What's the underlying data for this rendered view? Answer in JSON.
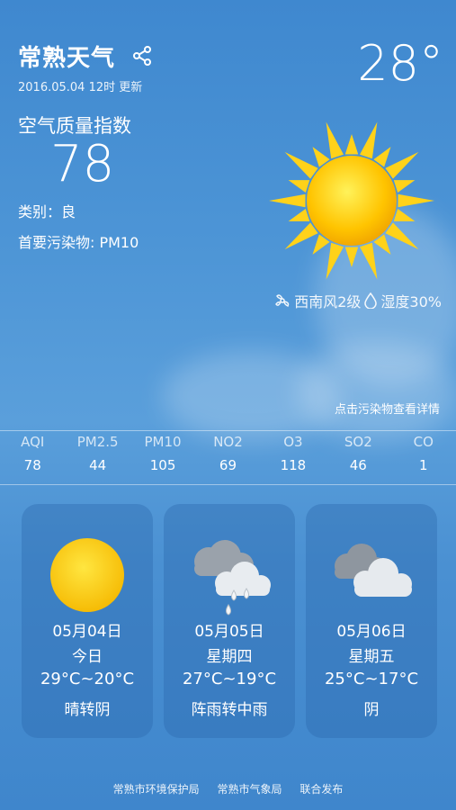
{
  "header": {
    "city": "常熟天气",
    "update_time": "2016.05.04 12时 更新",
    "temperature": "28°"
  },
  "air_quality": {
    "title": "空气质量指数",
    "value": "78",
    "category": "类别：良",
    "primary_pollutant": "首要污染物: PM10"
  },
  "conditions": {
    "wind": "西南风2级",
    "humidity": "湿度30%",
    "detail_link": "点击污染物查看详情"
  },
  "pollutants": [
    {
      "name": "AQI",
      "value": "78"
    },
    {
      "name": "PM2.5",
      "value": "44"
    },
    {
      "name": "PM10",
      "value": "105"
    },
    {
      "name": "NO2",
      "value": "69"
    },
    {
      "name": "O3",
      "value": "118"
    },
    {
      "name": "SO2",
      "value": "46"
    },
    {
      "name": "CO",
      "value": "1"
    }
  ],
  "forecast": [
    {
      "date": "05月04日",
      "day": "今日",
      "range": "29°C~20°C",
      "condition": "晴转阴",
      "icon": "sun-icon"
    },
    {
      "date": "05月05日",
      "day": "星期四",
      "range": "27°C~19°C",
      "condition": "阵雨转中雨",
      "icon": "rain-cloud-icon"
    },
    {
      "date": "05月06日",
      "day": "星期五",
      "range": "25°C~17°C",
      "condition": "阴",
      "icon": "cloud-icon"
    }
  ],
  "footer": [
    "常熟市环境保护局",
    "常熟市气象局",
    "联合发布"
  ],
  "colors": {
    "sun": "#ffd21a",
    "background": "#4d95d6"
  }
}
